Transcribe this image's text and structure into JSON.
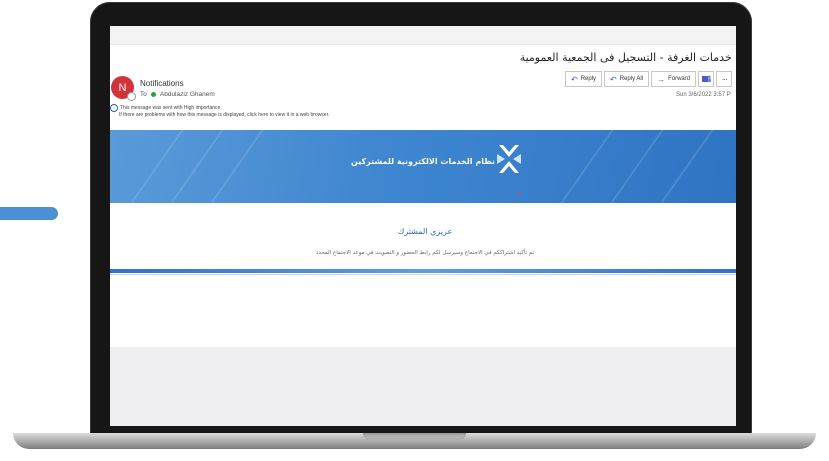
{
  "email": {
    "subject": "بوابة خدمات الغرفة - التسجيل فى الجمعية العمومية",
    "avatar_letter": "N",
    "sender": "Notifications",
    "to_label": "To",
    "recipient": "Abdulaziz Ghanem",
    "notice_line1": "This message was sent with High importance.",
    "notice_line2": "If there are problems with how this message is displayed, click here to view it in a web browser.",
    "date": "Sun 3/6/2022 3:57 P"
  },
  "actions": {
    "reply": "Reply",
    "reply_all": "Reply All",
    "forward": "Forward"
  },
  "banner": {
    "title": "نظام الخدمات الالكترونية للمشتركين"
  },
  "body": {
    "greeting": "عزيزي المشترك",
    "message": "تم تأكيد اشتراككم في الاجتماع وسيرسل لكم رابط الحضور و التصويت في موعد الاجتماع المحدد"
  },
  "colors": {
    "accent": "#4a90d6",
    "banner": "#3f86d0",
    "avatar": "#d13438"
  }
}
